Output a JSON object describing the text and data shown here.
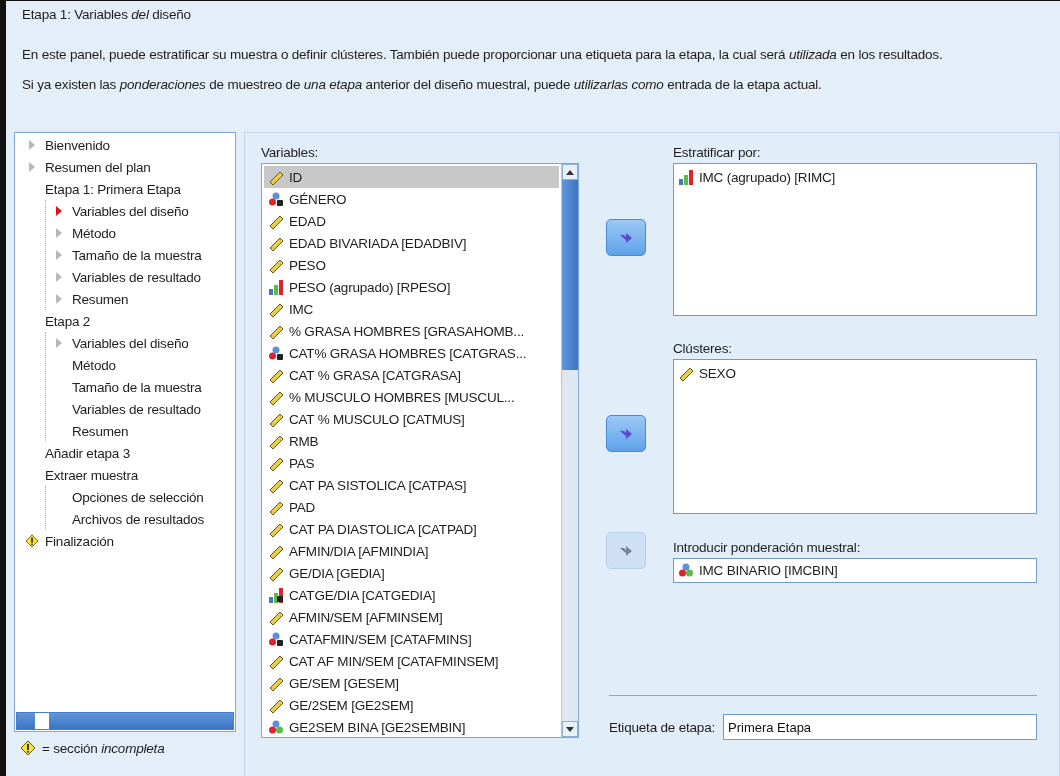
{
  "header": {
    "title": "Etapa 1: Variables *del* diseño",
    "paragraphs": [
      "En este panel, puede estratificar su muestra o definir  clústeres. También puede proporcionar una etiqueta para la etapa, la cual será *utilizada* en los resultados.",
      "Si ya existen las *ponderaciones* de muestreo de *una etapa* anterior del diseño muestral, puede *utilizarlas como* entrada de la etapa actual."
    ]
  },
  "tree": {
    "items": [
      {
        "label": "Bienvenido",
        "kind": "arrow"
      },
      {
        "label": "Resumen del plan",
        "kind": "arrow"
      },
      {
        "label": "Etapa 1: Primera Etapa",
        "kind": "plain",
        "children": [
          {
            "label": "Variables del diseño",
            "kind": "current"
          },
          {
            "label": "Método",
            "kind": "arrow"
          },
          {
            "label": "Tamaño de la muestra",
            "kind": "arrow"
          },
          {
            "label": "Variables de resultado",
            "kind": "arrow"
          },
          {
            "label": "Resumen",
            "kind": "arrow"
          }
        ]
      },
      {
        "label": "Etapa 2",
        "kind": "plain",
        "children": [
          {
            "label": "Variables del diseño",
            "kind": "arrow"
          },
          {
            "label": "Método",
            "kind": "plain"
          },
          {
            "label": "Tamaño de la muestra",
            "kind": "plain"
          },
          {
            "label": "Variables de resultado",
            "kind": "plain"
          },
          {
            "label": "Resumen",
            "kind": "plain"
          }
        ]
      },
      {
        "label": "Añadir etapa 3",
        "kind": "plain"
      },
      {
        "label": "Extraer muestra",
        "kind": "plain",
        "children": [
          {
            "label": "Opciones de selección",
            "kind": "plain"
          },
          {
            "label": "Archivos de resultados",
            "kind": "plain"
          }
        ]
      },
      {
        "label": "Finalización",
        "kind": "warning"
      }
    ],
    "legend": "= sección *incompleta*"
  },
  "variables": {
    "label": "Variables:",
    "items": [
      {
        "name": "ID",
        "kind": "scale",
        "selected": true
      },
      {
        "name": "GÉNERO",
        "kind": "nominal_string",
        "selected": false
      },
      {
        "name": "EDAD",
        "kind": "scale",
        "selected": false
      },
      {
        "name": "EDAD BIVARIADA [EDADBIV]",
        "kind": "scale",
        "selected": false
      },
      {
        "name": "PESO",
        "kind": "scale",
        "selected": false
      },
      {
        "name": "PESO (agrupado) [RPESO]",
        "kind": "ordinal",
        "selected": false
      },
      {
        "name": "IMC",
        "kind": "scale",
        "selected": false
      },
      {
        "name": "% GRASA HOMBRES [GRASAHOMB...",
        "kind": "scale",
        "selected": false
      },
      {
        "name": "CAT% GRASA HOMBRES [CATGRAS...",
        "kind": "nominal_string",
        "selected": false
      },
      {
        "name": "CAT % GRASA [CATGRASA]",
        "kind": "scale",
        "selected": false
      },
      {
        "name": "% MUSCULO HOMBRES [MUSCUL...",
        "kind": "scale",
        "selected": false
      },
      {
        "name": "CAT % MUSCULO [CATMUS]",
        "kind": "scale",
        "selected": false
      },
      {
        "name": "RMB",
        "kind": "scale",
        "selected": false
      },
      {
        "name": "PAS",
        "kind": "scale",
        "selected": false
      },
      {
        "name": "CAT PA SISTOLICA [CATPAS]",
        "kind": "scale",
        "selected": false
      },
      {
        "name": "PAD",
        "kind": "scale",
        "selected": false
      },
      {
        "name": "CAT PA DIASTOLICA [CATPAD]",
        "kind": "scale",
        "selected": false
      },
      {
        "name": "AFMIN/DIA [AFMINDIA]",
        "kind": "scale",
        "selected": false
      },
      {
        "name": "GE/DIA [GEDIA]",
        "kind": "scale",
        "selected": false
      },
      {
        "name": "CATGE/DIA [CATGEDIA]",
        "kind": "ordinal_string",
        "selected": false
      },
      {
        "name": "AFMIN/SEM [AFMINSEM]",
        "kind": "scale",
        "selected": false
      },
      {
        "name": "CATAFMIN/SEM [CATAFMINS]",
        "kind": "nominal_string",
        "selected": false
      },
      {
        "name": "CAT AF MIN/SEM [CATAFMINSEM]",
        "kind": "scale",
        "selected": false
      },
      {
        "name": "GE/SEM [GESEM]",
        "kind": "scale",
        "selected": false
      },
      {
        "name": "GE/2SEM [GE2SEM]",
        "kind": "scale",
        "selected": false
      },
      {
        "name": "GE2SEM BINA [GE2SEMBIN]",
        "kind": "nominal",
        "selected": false
      }
    ]
  },
  "stratify": {
    "label": "Estratificar por:",
    "button_disabled": false,
    "items": [
      {
        "name": "IMC (agrupado) [RIMC]",
        "kind": "ordinal"
      }
    ]
  },
  "clusters": {
    "label": "Clústeres:",
    "button_disabled": false,
    "items": [
      {
        "name": "SEXO",
        "kind": "scale"
      }
    ]
  },
  "weight": {
    "label": "Introducir ponderación muestral:",
    "button_disabled": true,
    "item": {
      "name": "IMC BINARIO [IMCBIN]",
      "kind": "nominal"
    }
  },
  "stage_label": {
    "label": "Etiqueta de etapa:",
    "value": "Primera Etapa"
  }
}
